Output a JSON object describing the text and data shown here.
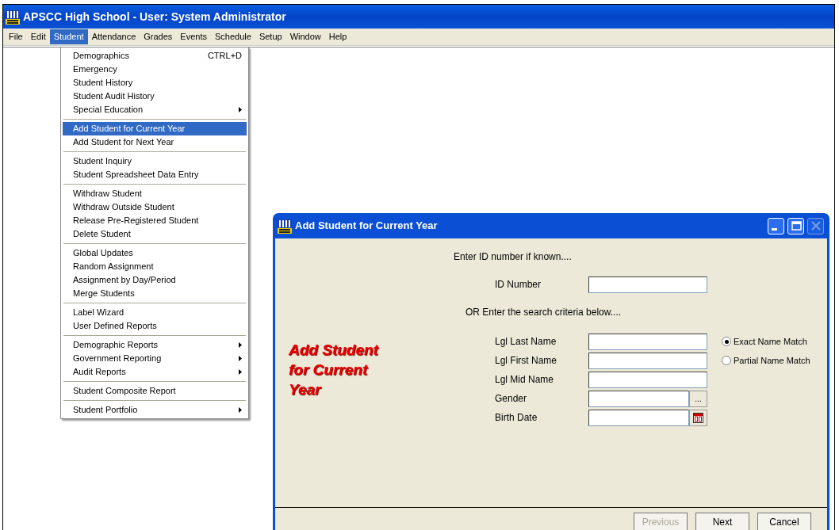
{
  "window": {
    "title": "APSCC High School - User: System Administrator"
  },
  "menubar": [
    {
      "label": "File",
      "selected": false
    },
    {
      "label": "Edit",
      "selected": false
    },
    {
      "label": "Student",
      "selected": true
    },
    {
      "label": "Attendance",
      "selected": false
    },
    {
      "label": "Grades",
      "selected": false
    },
    {
      "label": "Events",
      "selected": false
    },
    {
      "label": "Schedule",
      "selected": false
    },
    {
      "label": "Setup",
      "selected": false
    },
    {
      "label": "Window",
      "selected": false
    },
    {
      "label": "Help",
      "selected": false
    }
  ],
  "menu": {
    "items": [
      {
        "kind": "item",
        "label": "Demographics",
        "shortcut": "CTRL+D",
        "submenu": false,
        "selected": false
      },
      {
        "kind": "item",
        "label": "Emergency",
        "submenu": false,
        "selected": false
      },
      {
        "kind": "item",
        "label": "Student History",
        "submenu": false,
        "selected": false
      },
      {
        "kind": "item",
        "label": "Student Audit History",
        "submenu": false,
        "selected": false
      },
      {
        "kind": "item",
        "label": "Special Education",
        "submenu": true,
        "selected": false
      },
      {
        "kind": "separator"
      },
      {
        "kind": "item",
        "label": "Add Student for Current Year",
        "submenu": false,
        "selected": true
      },
      {
        "kind": "item",
        "label": "Add Student for Next Year",
        "submenu": false,
        "selected": false
      },
      {
        "kind": "separator"
      },
      {
        "kind": "item",
        "label": "Student Inquiry",
        "submenu": false,
        "selected": false
      },
      {
        "kind": "item",
        "label": "Student Spreadsheet Data Entry",
        "submenu": false,
        "selected": false
      },
      {
        "kind": "separator"
      },
      {
        "kind": "item",
        "label": "Withdraw Student",
        "submenu": false,
        "selected": false
      },
      {
        "kind": "item",
        "label": "Withdraw Outside Student",
        "submenu": false,
        "selected": false
      },
      {
        "kind": "item",
        "label": "Release Pre-Registered Student",
        "submenu": false,
        "selected": false
      },
      {
        "kind": "item",
        "label": "Delete Student",
        "submenu": false,
        "selected": false
      },
      {
        "kind": "separator"
      },
      {
        "kind": "item",
        "label": "Global Updates",
        "submenu": false,
        "selected": false
      },
      {
        "kind": "item",
        "label": "Random Assignment",
        "submenu": false,
        "selected": false
      },
      {
        "kind": "item",
        "label": "Assignment by Day/Period",
        "submenu": false,
        "selected": false
      },
      {
        "kind": "item",
        "label": "Merge Students",
        "submenu": false,
        "selected": false
      },
      {
        "kind": "separator"
      },
      {
        "kind": "item",
        "label": "Label Wizard",
        "submenu": false,
        "selected": false
      },
      {
        "kind": "item",
        "label": "User Defined Reports",
        "submenu": false,
        "selected": false
      },
      {
        "kind": "separator"
      },
      {
        "kind": "item",
        "label": "Demographic Reports",
        "submenu": true,
        "selected": false
      },
      {
        "kind": "item",
        "label": "Government Reporting",
        "submenu": true,
        "selected": false
      },
      {
        "kind": "item",
        "label": "Audit Reports",
        "submenu": true,
        "selected": false
      },
      {
        "kind": "separator"
      },
      {
        "kind": "item",
        "label": "Student Composite Report",
        "submenu": false,
        "selected": false
      },
      {
        "kind": "separator"
      },
      {
        "kind": "item",
        "label": "Student Portfolio",
        "submenu": true,
        "selected": false
      }
    ]
  },
  "dialog": {
    "title": "Add Student for Current Year",
    "window_controls": [
      {
        "kind": "minimize",
        "disabled": false
      },
      {
        "kind": "maximize",
        "disabled": false
      },
      {
        "kind": "close",
        "disabled": true
      }
    ],
    "intro": "Enter ID number if known....",
    "id_label": "ID Number",
    "or_text": "OR  Enter the search criteria below....",
    "banner": "Add Student for Current Year",
    "fields": [
      {
        "label": "Lgl Last Name",
        "kind": "text"
      },
      {
        "label": "Lgl First Name",
        "kind": "text"
      },
      {
        "label": "Lgl Mid Name",
        "kind": "text"
      },
      {
        "label": "Gender",
        "kind": "lookup",
        "button": "..."
      },
      {
        "label": "Birth Date",
        "kind": "date"
      }
    ],
    "match_options": [
      {
        "label": "Exact Name Match",
        "selected": true
      },
      {
        "label": "Partial Name Match",
        "selected": false
      }
    ],
    "buttons": [
      {
        "label": "Previous",
        "disabled": true
      },
      {
        "label": "Next",
        "disabled": false
      },
      {
        "label": "Cancel",
        "disabled": false
      }
    ]
  }
}
